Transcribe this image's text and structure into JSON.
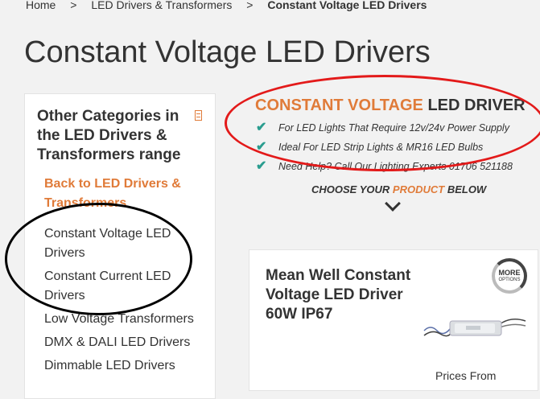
{
  "breadcrumb": {
    "home": "Home",
    "separator": ">",
    "parent": "LED Drivers & Transformers",
    "current": "Constant Voltage LED Drivers"
  },
  "page_title": "Constant Voltage LED Drivers",
  "sidebar": {
    "heading": "Other Categories in the LED Drivers & Transformers range",
    "back_link": "Back to LED Drivers & Transformers",
    "categories": [
      "Constant Voltage LED Drivers",
      "Constant Current LED Drivers",
      "Low Voltage Transformers",
      "DMX & DALI LED Drivers",
      "Dimmable LED Drivers"
    ]
  },
  "promo": {
    "title_part1": "CONSTANT VOLTAGE",
    "title_part2": "LED DRIVER",
    "features": [
      "For LED Lights That Require 12v/24v Power Supply",
      "Ideal For LED Strip Lights & MR16 LED Bulbs",
      "Need Help? Call Our Lighting Experts 01706 521188"
    ],
    "choose_prefix": "CHOOSE YOUR",
    "choose_highlight": "PRODUCT",
    "choose_suffix": "BELOW"
  },
  "product": {
    "name": "Mean Well Constant Voltage LED Driver 60W IP67",
    "badge_line1": "MORE",
    "badge_line2": "OPTIONS",
    "prices_label": "Prices From"
  },
  "colors": {
    "accent": "#e07b39",
    "check": "#2a9d8f",
    "annotation_red": "#e31a1a",
    "annotation_black": "#000000"
  }
}
